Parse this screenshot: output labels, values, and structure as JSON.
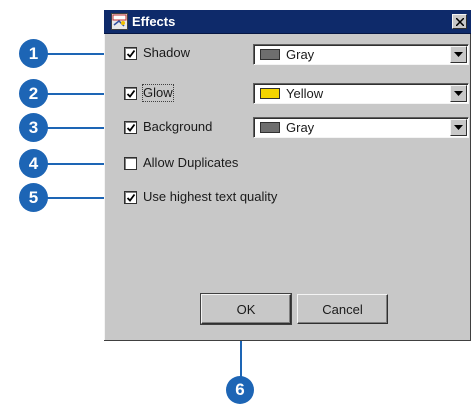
{
  "window": {
    "title": "Effects"
  },
  "options": [
    {
      "label": "Shadow",
      "checked": true,
      "color_name": "Gray",
      "swatch": "#6e6e6e"
    },
    {
      "label": "Glow",
      "checked": true,
      "color_name": "Yellow",
      "swatch": "#f4d400"
    },
    {
      "label": "Background",
      "checked": true,
      "color_name": "Gray",
      "swatch": "#6e6e6e"
    },
    {
      "label": "Allow Duplicates",
      "checked": false
    },
    {
      "label": "Use highest text quality",
      "checked": true
    }
  ],
  "buttons": {
    "ok": "OK",
    "cancel": "Cancel"
  },
  "callouts": [
    "1",
    "2",
    "3",
    "4",
    "5",
    "6"
  ],
  "colors": {
    "callout": "#1d65b5",
    "titlebar": "#0e2a6a",
    "dialog": "#c8c8c8"
  }
}
